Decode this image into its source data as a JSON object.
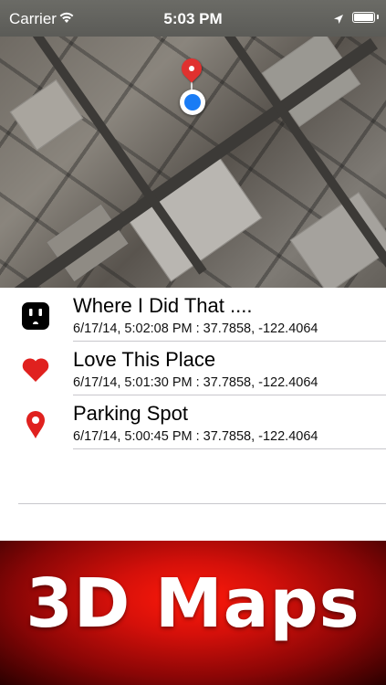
{
  "status_bar": {
    "carrier": "Carrier",
    "time": "5:03 PM",
    "wifi_icon": "wifi-icon",
    "location_icon": "location-arrow-icon",
    "battery_icon": "battery-icon",
    "battery_level": 1.0
  },
  "map": {
    "style": "satellite-3d",
    "pin_icon": "red-map-pin-icon",
    "user_location_icon": "current-location-icon",
    "pin_color": "#e0312f",
    "user_location_color": "#1a7cf5"
  },
  "places": [
    {
      "icon": "power-outlet-icon",
      "icon_color": "#000000",
      "title": "Where I Did That ....",
      "subtitle": "6/17/14, 5:02:08 PM : 37.7858, -122.4064"
    },
    {
      "icon": "heart-icon",
      "icon_color": "#e0211f",
      "title": "Love This Place",
      "subtitle": "6/17/14, 5:01:30 PM : 37.7858, -122.4064"
    },
    {
      "icon": "map-pin-icon",
      "icon_color": "#e0211f",
      "title": "Parking Spot",
      "subtitle": "6/17/14, 5:00:45 PM : 37.7858, -122.4064"
    }
  ],
  "banner": {
    "title": "3D Maps",
    "color": "#d4100a"
  }
}
